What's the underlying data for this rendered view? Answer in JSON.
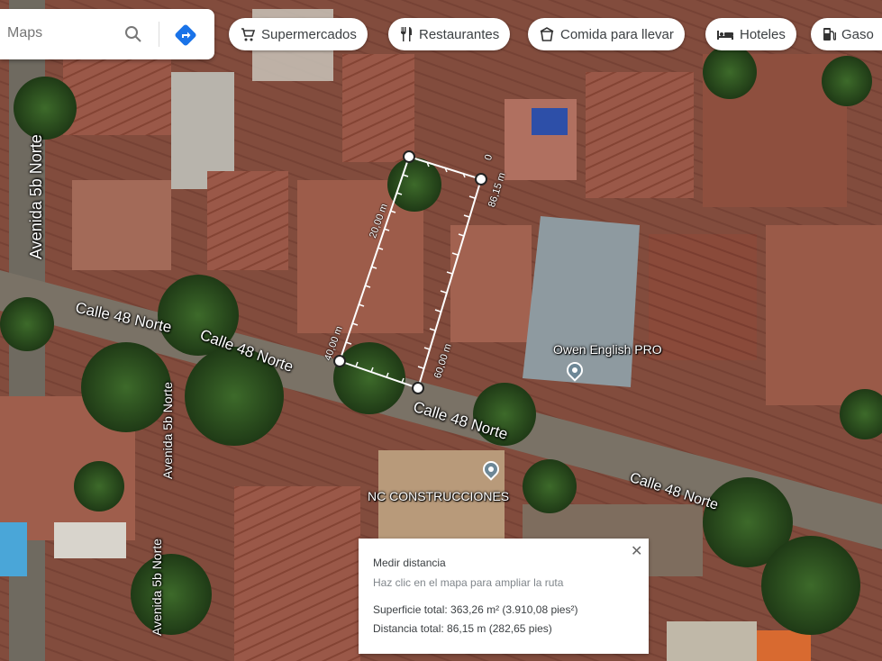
{
  "search": {
    "placeholder": "Maps"
  },
  "chips": [
    {
      "label": "Supermercados",
      "icon": "cart-icon"
    },
    {
      "label": "Restaurantes",
      "icon": "fork-knife-icon"
    },
    {
      "label": "Comida para llevar",
      "icon": "takeout-icon"
    },
    {
      "label": "Hoteles",
      "icon": "bed-icon"
    },
    {
      "label": "Gaso",
      "icon": "fuel-icon"
    }
  ],
  "streets": {
    "avenida_top": "Avenida 5b Norte",
    "avenida_left_mid": "Avenida 5b Norte",
    "avenida_left_bottom": "Avenida 5b Norte",
    "calle_left": "Calle 48 Norte",
    "calle_mid": "Calle 48 Norte",
    "calle_center": "Calle 48 Norte",
    "calle_right": "Calle 48 Norte"
  },
  "pois": [
    {
      "name": "Owen English PRO"
    },
    {
      "name": "NC CONSTRUCCIONES"
    }
  ],
  "measurements": {
    "top": "0",
    "right_top": "86,15 m",
    "left_top": "20,00 m",
    "left_bottom": "40,00 m",
    "right_bottom": "60,00 m"
  },
  "panel": {
    "title": "Medir distancia",
    "hint": "Haz clic en el mapa para ampliar la ruta",
    "area": "Superficie total: 363,26 m² (3.910,08 pies²)",
    "distance": "Distancia total: 86,15 m (282,65 pies)"
  },
  "colors": {
    "accent": "#1a73e8",
    "measure_line": "#ffffff"
  }
}
